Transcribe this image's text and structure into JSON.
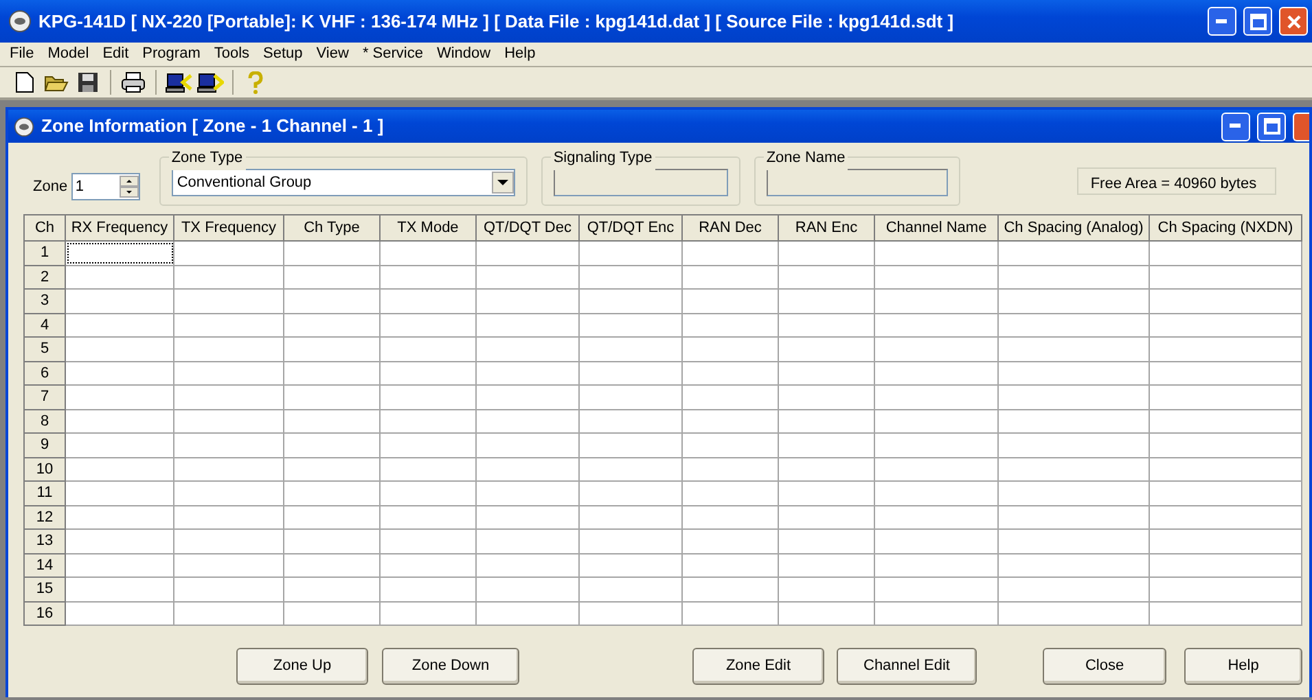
{
  "window": {
    "title": "KPG-141D  [ NX-220  [Portable]: K VHF : 136-174 MHz ] [ Data File : kpg141d.dat ] [ Source File : kpg141d.sdt ]"
  },
  "menu": [
    "File",
    "Model",
    "Edit",
    "Program",
    "Tools",
    "Setup",
    "View",
    "* Service",
    "Window",
    "Help"
  ],
  "child_window": {
    "title": "Zone Information [ Zone - 1  Channel - 1 ]"
  },
  "zone": {
    "label": "Zone",
    "value": "1"
  },
  "zone_type": {
    "label": "Zone Type",
    "value": "Conventional Group"
  },
  "signaling_type": {
    "label": "Signaling Type"
  },
  "zone_name": {
    "label": "Zone Name"
  },
  "free_area": "Free Area = 40960 bytes",
  "table": {
    "columns": [
      "Ch",
      "RX Frequency",
      "TX Frequency",
      "Ch Type",
      "TX Mode",
      "QT/DQT Dec",
      "QT/DQT Enc",
      "RAN Dec",
      "RAN Enc",
      "Channel Name",
      "Ch Spacing (Analog)",
      "Ch Spacing (NXDN)"
    ],
    "rows": [
      {
        "ch": "1",
        "focused": true
      },
      {
        "ch": "2",
        "focused": false
      },
      {
        "ch": "3",
        "focused": false
      },
      {
        "ch": "4",
        "focused": false
      },
      {
        "ch": "5",
        "focused": false
      },
      {
        "ch": "6",
        "focused": false
      },
      {
        "ch": "7",
        "focused": false
      },
      {
        "ch": "8",
        "focused": false
      },
      {
        "ch": "9",
        "focused": false
      },
      {
        "ch": "10",
        "focused": false
      },
      {
        "ch": "11",
        "focused": false
      },
      {
        "ch": "12",
        "focused": false
      },
      {
        "ch": "13",
        "focused": false
      },
      {
        "ch": "14",
        "focused": false
      },
      {
        "ch": "15",
        "focused": false
      },
      {
        "ch": "16",
        "focused": false
      }
    ]
  },
  "buttons": [
    {
      "label": "Zone Up"
    },
    {
      "label": "Zone Down"
    },
    {
      "label": "Zone Edit"
    },
    {
      "label": "Channel Edit"
    },
    {
      "label": "Close"
    },
    {
      "label": "Help"
    }
  ]
}
